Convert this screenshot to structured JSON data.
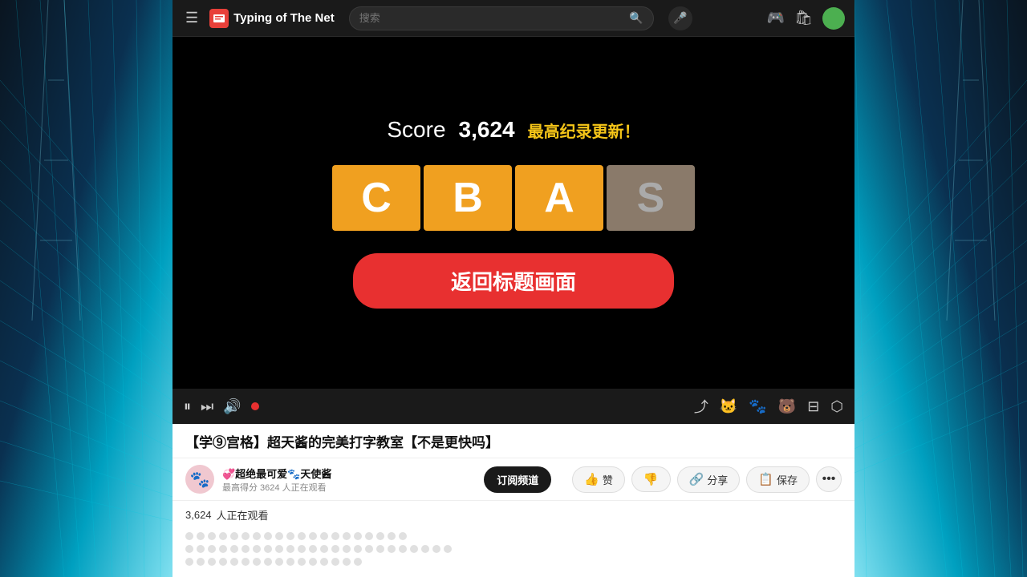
{
  "header": {
    "menu_icon": "☰",
    "logo_text": "Typing of The Net",
    "search_placeholder": "搜索",
    "search_icon": "🔍",
    "mic_icon": "🎤"
  },
  "video": {
    "score_label": "Score",
    "score_value": "3,624",
    "score_badge": "最高纪录更新！",
    "grades": [
      {
        "letter": "C",
        "type": "grade-c"
      },
      {
        "letter": "B",
        "type": "grade-b"
      },
      {
        "letter": "A",
        "type": "grade-a"
      },
      {
        "letter": "S",
        "type": "grade-s"
      }
    ],
    "return_button": "返回标题画面"
  },
  "controls": {
    "play_icon": "⏸",
    "next_icon": "⏭",
    "volume_icon": "🔊"
  },
  "channel": {
    "name": "💞超绝最可爱🐾天使酱",
    "sub_info": "最高得分 3624 人正在观看",
    "subscribe_label": "订阅频道",
    "like_label": "赞",
    "dislike_icon": "👎",
    "share_label": "分享",
    "save_label": "保存"
  },
  "video_title": "【学⑨宫格】超天酱的完美打字教室【不是更快吗】",
  "stats": {
    "viewers_count": "3,624",
    "viewers_label": "人正在观看"
  },
  "comments": {
    "dot_rows": [
      {
        "count": 20
      },
      {
        "count": 24
      },
      {
        "count": 16
      }
    ]
  }
}
